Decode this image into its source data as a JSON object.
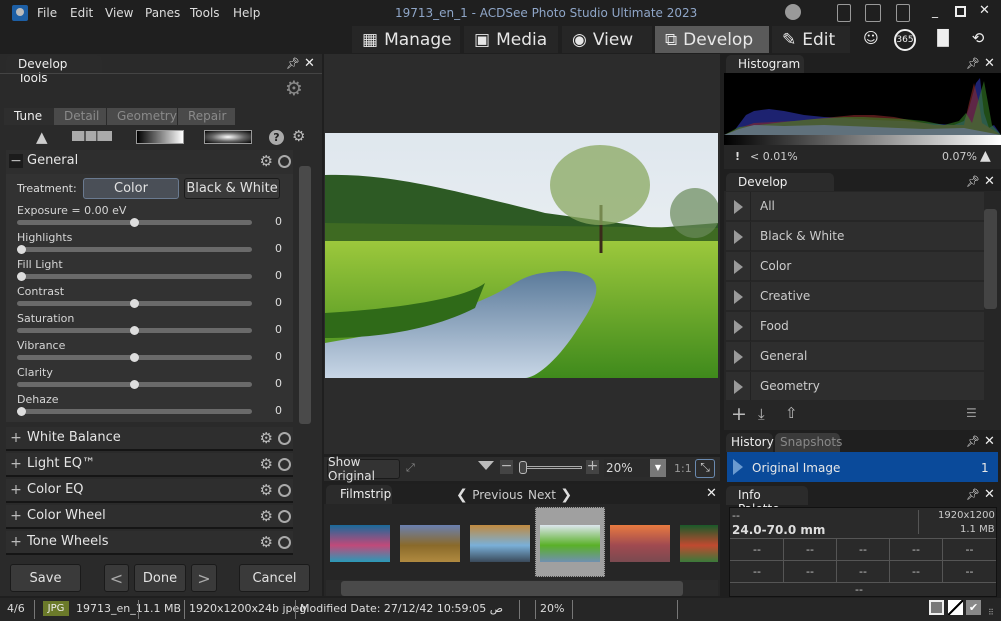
{
  "app": {
    "title": "19713_en_1 - ACDSee Photo Studio Ultimate 2023",
    "menu": [
      "File",
      "Edit",
      "View",
      "Panes",
      "Tools",
      "Help"
    ]
  },
  "nav": {
    "modes": [
      {
        "label": "Manage",
        "icon": "grid-icon"
      },
      {
        "label": "Media",
        "icon": "media-icon"
      },
      {
        "label": "View",
        "icon": "eye-icon"
      },
      {
        "label": "Develop",
        "icon": "develop-icon",
        "active": true
      },
      {
        "label": "Edit",
        "icon": "edit-icon"
      }
    ],
    "extra_icons": [
      "people-icon",
      "365-icon",
      "stats-icon",
      "eye-refresh-icon"
    ],
    "badge_365": "365"
  },
  "develop_tools": {
    "title": "Develop Tools",
    "tabs": [
      "Tune",
      "Detail",
      "Geometry",
      "Repair"
    ],
    "active_tab": "Tune",
    "general": {
      "label": "General",
      "treatment_label": "Treatment:",
      "treatment_options": [
        "Color",
        "Black & White"
      ],
      "treatment_selected": "Color",
      "sliders": [
        {
          "label": "Exposure = 0.00 eV",
          "value": "0",
          "position": 0.5
        },
        {
          "label": "Highlights",
          "value": "0",
          "position": 0.0
        },
        {
          "label": "Fill Light",
          "value": "0",
          "position": 0.0
        },
        {
          "label": "Contrast",
          "value": "0",
          "position": 0.5
        },
        {
          "label": "Saturation",
          "value": "0",
          "position": 0.5
        },
        {
          "label": "Vibrance",
          "value": "0",
          "position": 0.5
        },
        {
          "label": "Clarity",
          "value": "0",
          "position": 0.5
        },
        {
          "label": "Dehaze",
          "value": "0",
          "position": 0.0
        }
      ]
    },
    "groups": [
      "White Balance",
      "Light EQ™",
      "Color EQ",
      "Color Wheel",
      "Tone Wheels"
    ],
    "buttons": {
      "save": "Save",
      "prev": "<",
      "done": "Done",
      "next": ">",
      "cancel": "Cancel"
    }
  },
  "viewer": {
    "show_original": "Show Original",
    "zoom": "20%",
    "one_to_one": "1:1"
  },
  "filmstrip": {
    "title": "Filmstrip",
    "previous": "Previous",
    "next": "Next",
    "thumbnails": [
      {
        "name": "coral-reef",
        "colors": [
          "#1a6a9a",
          "#c04a7a",
          "#2a9ab8"
        ]
      },
      {
        "name": "mountain-hay-field",
        "colors": [
          "#6a80b0",
          "#8a6a2a",
          "#b08a40"
        ]
      },
      {
        "name": "autumn-lake",
        "colors": [
          "#c08a40",
          "#7ab0d8",
          "#3a4a5a"
        ]
      },
      {
        "name": "meadow-river",
        "colors": [
          "#dde6ee",
          "#5ab028",
          "#7090b0"
        ],
        "selected": true
      },
      {
        "name": "sunset-sea",
        "colors": [
          "#e87a40",
          "#a04a50",
          "#7a4a50"
        ]
      },
      {
        "name": "flowers",
        "colors": [
          "#1a5a2a",
          "#c04a30",
          "#3a7a3a"
        ]
      }
    ]
  },
  "histogram": {
    "title": "Histogram",
    "low_clip": "< 0.01%",
    "high_clip": "0.07%"
  },
  "presets": {
    "title": "Develop Presets",
    "items": [
      "All",
      "Black & White",
      "Color",
      "Creative",
      "Food",
      "General",
      "Geometry"
    ]
  },
  "history": {
    "tabs": [
      "History",
      "Snapshots"
    ],
    "items": [
      {
        "label": "Original Image",
        "index": "1"
      }
    ]
  },
  "info_palette": {
    "title": "Info Palette",
    "camera": "--",
    "lens": "24.0-70.0 mm",
    "dimensions": "1920x1200",
    "size": "1.1 MB",
    "row1": [
      "--",
      "--",
      "--",
      "--",
      "--"
    ],
    "row2": [
      "--",
      "--",
      "--",
      "--",
      "--"
    ],
    "bottom": "--"
  },
  "status": {
    "position": "4/6",
    "format": "JPG",
    "filename": "19713_en_1",
    "filesize": "1.1 MB",
    "image_info": "1920x1200x24b jpeg",
    "modified": "Modified Date: 27/12/42 10:59:05 ص",
    "zoom": "20%"
  },
  "colors": {
    "accent": "#0a4a9a",
    "active_mode": "#5a5a5a",
    "jpg_badge": "#6b7a2a"
  }
}
